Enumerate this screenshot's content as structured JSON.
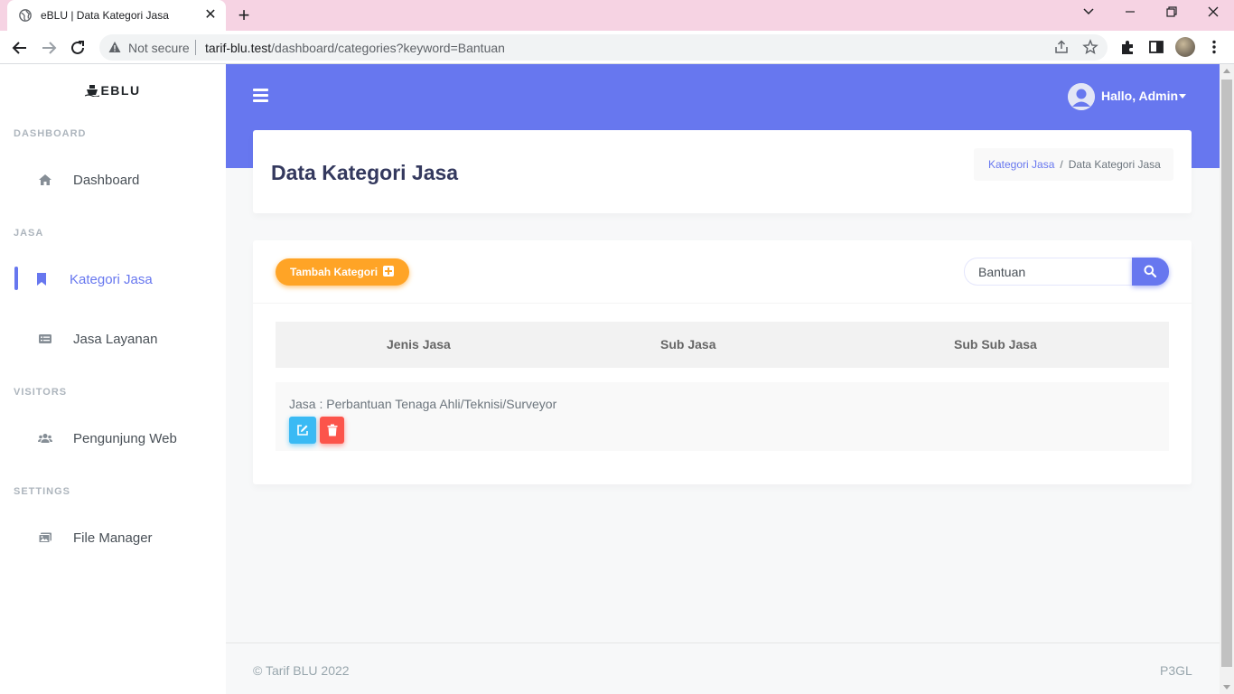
{
  "browser": {
    "tab_title": "eBLU | Data Kategori Jasa",
    "tab_close": "✕",
    "new_tab": "+",
    "security_label": "Not secure",
    "url_host": "tarif-blu.test",
    "url_path": "/dashboard/categories?keyword=Bantuan",
    "window_minimize": "—",
    "window_restore": "❐",
    "window_close": "✕",
    "tab_search": "⌄"
  },
  "sidebar": {
    "brand": "EBLU",
    "sections": [
      {
        "heading": "DASHBOARD",
        "items": [
          {
            "label": "Dashboard",
            "icon": "home-icon"
          }
        ]
      },
      {
        "heading": "JASA",
        "items": [
          {
            "label": "Kategori Jasa",
            "icon": "bookmark-icon",
            "active": true
          },
          {
            "label": "Jasa Layanan",
            "icon": "list-alt-icon"
          }
        ]
      },
      {
        "heading": "VISITORS",
        "items": [
          {
            "label": "Pengunjung Web",
            "icon": "users-icon"
          }
        ]
      },
      {
        "heading": "SETTINGS",
        "items": [
          {
            "label": "File Manager",
            "icon": "images-icon"
          }
        ]
      }
    ]
  },
  "navbar": {
    "user_greeting": "Hallo, Admin"
  },
  "header": {
    "title": "Data Kategori Jasa",
    "breadcrumb": [
      {
        "label": "Kategori Jasa",
        "link": true
      },
      {
        "label": "Data Kategori Jasa",
        "link": false
      }
    ],
    "breadcrumb_separator": "/"
  },
  "toolbar": {
    "add_button_label": "Tambah Kategori",
    "search_value": "Bantuan"
  },
  "table": {
    "columns": [
      "Jenis Jasa",
      "Sub Jasa",
      "Sub Sub Jasa"
    ],
    "rows": [
      {
        "text": "Jasa : Perbantuan Tenaga Ahli/Teknisi/Surveyor"
      }
    ]
  },
  "footer": {
    "copyright": "© Tarif BLU 2022",
    "right": "P3GL"
  },
  "colors": {
    "primary": "#6777ef",
    "warning": "#ffa426",
    "info": "#3abaf4",
    "danger": "#fc544b",
    "tabstrip": "#f6d3e3"
  }
}
